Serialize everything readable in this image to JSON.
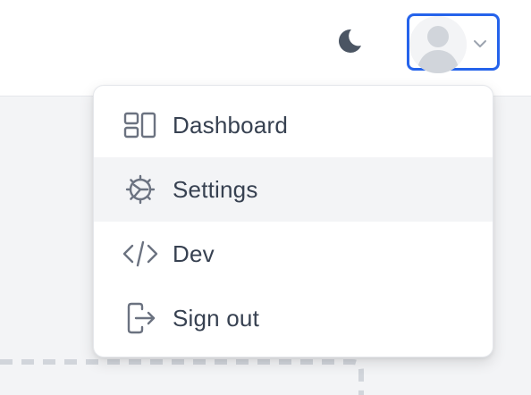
{
  "header": {
    "theme_toggle_icon": "moon-icon",
    "user_menu": {
      "avatar_icon": "user-avatar-icon",
      "chevron_icon": "chevron-down-icon",
      "focus_color": "#2563eb"
    }
  },
  "dropdown": {
    "items": [
      {
        "label": "Dashboard",
        "icon": "dashboard-icon",
        "active": false
      },
      {
        "label": "Settings",
        "icon": "gear-icon",
        "active": true
      },
      {
        "label": "Dev",
        "icon": "code-icon",
        "active": false
      },
      {
        "label": "Sign out",
        "icon": "sign-out-icon",
        "active": false
      }
    ]
  },
  "colors": {
    "text": "#374151",
    "icon": "#6b7280",
    "hover_bg": "#f3f4f6",
    "page_bg": "#f3f4f6"
  }
}
